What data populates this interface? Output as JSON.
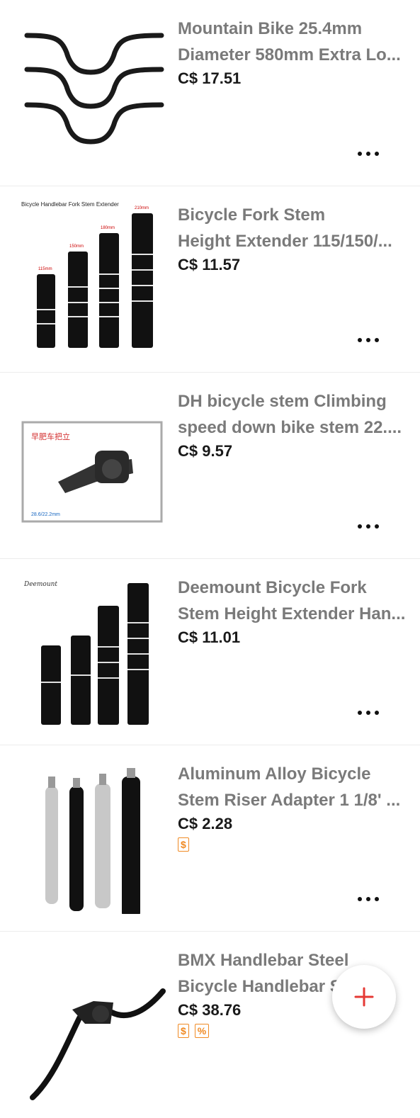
{
  "products": [
    {
      "title": "Mountain Bike 25.4mm Diameter 580mm Extra Lo...",
      "title_line1": "Mountain Bike 25.4mm",
      "title_line2": "Diameter 580mm Extra Lo...",
      "price": "C$ 17.51",
      "badges": []
    },
    {
      "title": "Bicycle Fork Stem Height Extender 115/150/...",
      "title_line1": "Bicycle Fork Stem",
      "title_line2": "Height Extender 115/150/...",
      "price": "C$ 11.57",
      "badges": [],
      "image_caption": "Bicycle Handlebar Fork Stem Extender",
      "image_labels": [
        "115mm",
        "150mm",
        "180mm",
        "210mm"
      ]
    },
    {
      "title": "DH bicycle stem Climbing speed down bike stem 22....",
      "title_line1": "DH bicycle stem Climbing",
      "title_line2": "speed down bike stem 22....",
      "price": "C$ 9.57",
      "badges": [],
      "image_caption_top": "早肥车把立",
      "image_caption_bottom": "28.6/22.2mm"
    },
    {
      "title": "Deemount Bicycle Fork Stem Height Extender Han...",
      "title_line1": "Deemount Bicycle Fork",
      "title_line2": "Stem Height Extender Han...",
      "price": "C$ 11.01",
      "badges": [],
      "image_brand": "Deemount"
    },
    {
      "title": "Aluminum Alloy Bicycle Stem Riser Adapter 1 1/8' ...",
      "title_line1": "Aluminum Alloy Bicycle",
      "title_line2": "Stem Riser Adapter 1 1/8' ...",
      "price": "C$ 2.28",
      "badges": [
        "$"
      ]
    },
    {
      "title": "BMX Handlebar Steel Bicycle Handlebar S...",
      "title_line1": "BMX Handlebar Steel",
      "title_line2": "Bicycle Handlebar S...",
      "price": "C$ 38.76",
      "badges": [
        "$",
        "%"
      ]
    }
  ],
  "colors": {
    "fab_plus": "#e53935",
    "badge": "#f08a24",
    "title": "#7a7a7a"
  },
  "icons": {
    "more": "more-dots-icon",
    "add": "plus-icon"
  }
}
